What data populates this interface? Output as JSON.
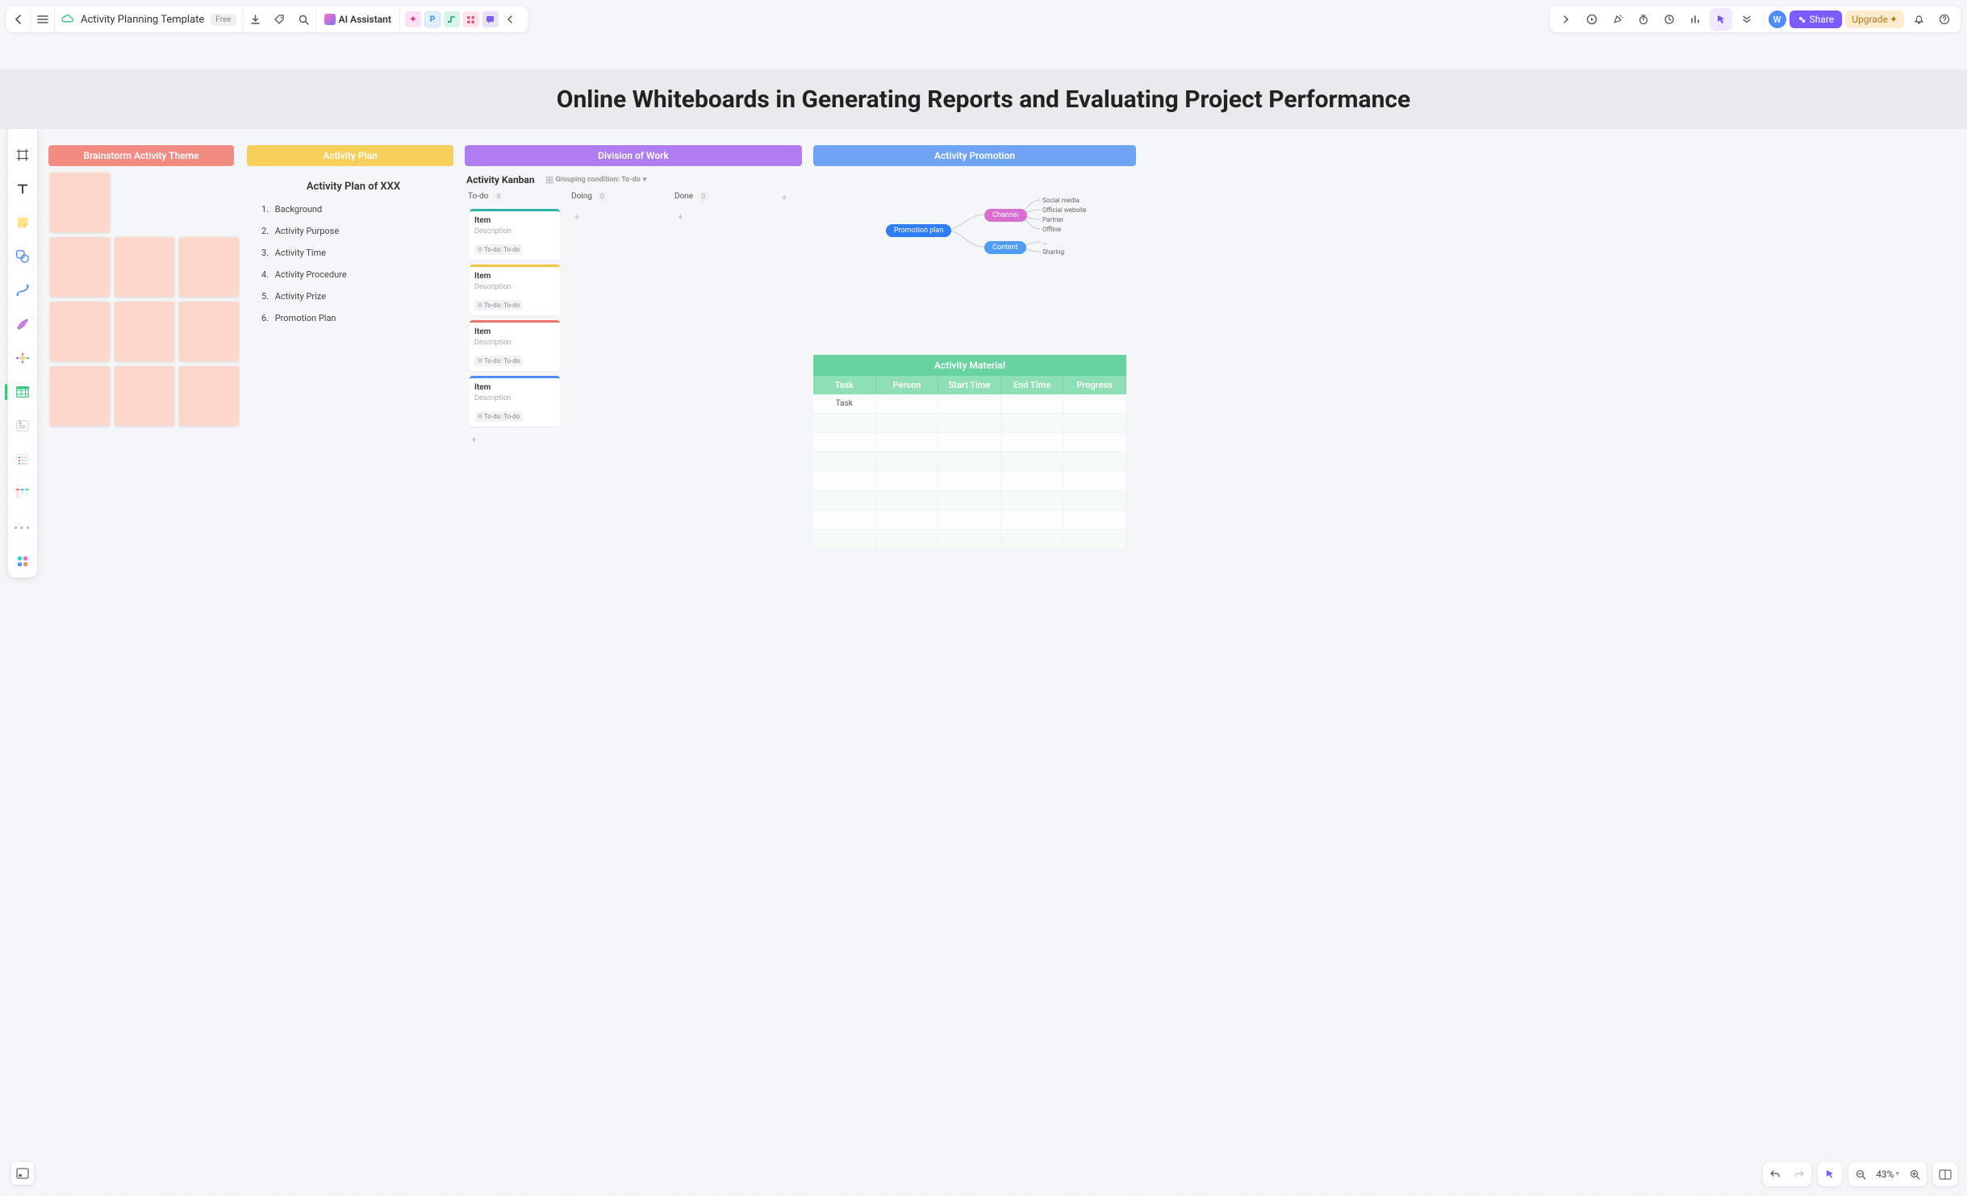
{
  "topbar": {
    "doc_title": "Activity Planning Template",
    "doc_badge": "Free",
    "ai_label": "AI Assistant",
    "mini_p": "P"
  },
  "topbar_right": {
    "avatar_letter": "W",
    "share_label": "Share",
    "upgrade_label": "Upgrade",
    "upgrade_icon": "✦"
  },
  "canvas": {
    "title": "Online Whiteboards in Generating Reports and Evaluating Project Performance"
  },
  "sections": {
    "brainstorm": {
      "title": "Brainstorm Activity Theme"
    },
    "plan": {
      "title": "Activity Plan"
    },
    "division": {
      "title": "Division of Work"
    },
    "promotion": {
      "title": "Activity Promotion"
    }
  },
  "plan": {
    "heading": "Activity Plan of XXX",
    "items": [
      "Background",
      "Activity Purpose",
      "Activity Time",
      "Activity Procedure",
      "Activity Prize",
      "Promotion Plan"
    ]
  },
  "kanban": {
    "title": "Activity Kanban",
    "grouping_label": "Grouping condition: To-do",
    "columns": [
      {
        "name": "To-do",
        "count": 4
      },
      {
        "name": "Doing",
        "count": 0
      },
      {
        "name": "Done",
        "count": 0
      }
    ],
    "cards": [
      {
        "title": "Item",
        "desc": "Description",
        "tag": "To-do: To-do",
        "color": "#2bb6a8"
      },
      {
        "title": "Item",
        "desc": "Description",
        "tag": "To-do: To-do",
        "color": "#f4c542"
      },
      {
        "title": "Item",
        "desc": "Description",
        "tag": "To-do: To-do",
        "color": "#e9756b"
      },
      {
        "title": "Item",
        "desc": "Description",
        "tag": "To-do: To-do",
        "color": "#4f8cff"
      }
    ],
    "add_label": "+"
  },
  "mindmap": {
    "root": "Promotion plan",
    "branch_channel": "Channel",
    "branch_content": "Content",
    "leaves_channel": [
      "Social media",
      "Official website",
      "Partner",
      "Offline"
    ],
    "leaves_content": [
      "…",
      "Sharing"
    ]
  },
  "material": {
    "title": "Activity Material",
    "headers": [
      "Task",
      "Person",
      "Start Time",
      "End Time",
      "Progress"
    ],
    "rows": [
      [
        "Task",
        "",
        "",
        "",
        ""
      ],
      [
        "",
        "",
        "",
        "",
        ""
      ],
      [
        "",
        "",
        "",
        "",
        ""
      ],
      [
        "",
        "",
        "",
        "",
        ""
      ],
      [
        "",
        "",
        "",
        "",
        ""
      ],
      [
        "",
        "",
        "",
        "",
        ""
      ],
      [
        "",
        "",
        "",
        "",
        ""
      ],
      [
        "",
        "",
        "",
        "",
        ""
      ]
    ]
  },
  "bottom_right": {
    "zoom": "43%"
  }
}
